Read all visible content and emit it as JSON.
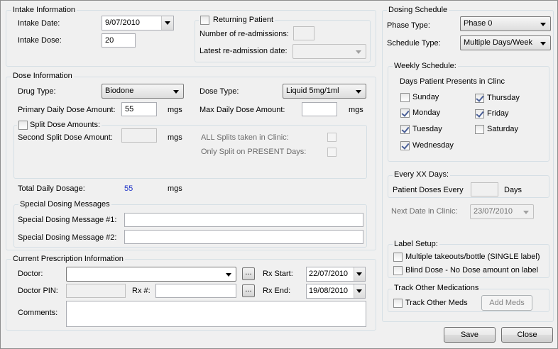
{
  "intake": {
    "title": "Intake Information",
    "date_label": "Intake Date:",
    "date_value": "9/07/2010",
    "dose_label": "Intake Dose:",
    "dose_value": "20",
    "returning_label": "Returning Patient",
    "returning_checked": false,
    "readmissions_label": "Number of re-admissions:",
    "readmissions_value": "",
    "latest_readmission_label": "Latest re-admission date:",
    "latest_readmission_value": ""
  },
  "dose_info": {
    "title": "Dose Information",
    "drug_type_label": "Drug Type:",
    "drug_type_value": "Biodone",
    "dose_type_label": "Dose Type:",
    "dose_type_value": "Liquid 5mg/1ml",
    "primary_label": "Primary Daily Dose Amount:",
    "primary_value": "55",
    "primary_unit": "mgs",
    "max_label": "Max Daily Dose Amount:",
    "max_value": "",
    "max_unit": "mgs",
    "split_label": "Split Dose Amounts:",
    "second_split_label": "Second Split Dose Amount:",
    "second_split_value": "",
    "second_split_unit": "mgs",
    "all_splits_label": "ALL Splits taken in Clinic:",
    "only_split_label": "Only Split on PRESENT Days:",
    "total_label": "Total Daily Dosage:",
    "total_value": "55",
    "total_unit": "mgs"
  },
  "special": {
    "title": "Special Dosing Messages",
    "msg1_label": "Special Dosing Message #1:",
    "msg1_value": "",
    "msg2_label": "Special Dosing Message #2:",
    "msg2_value": ""
  },
  "prescription": {
    "title": "Current Prescription Information",
    "doctor_label": "Doctor:",
    "doctor_value": "",
    "rx_start_label": "Rx Start:",
    "rx_start_value": "22/07/2010",
    "pin_label": "Doctor PIN:",
    "pin_value": "",
    "rx_num_label": "Rx #:",
    "rx_num_value": "",
    "rx_end_label": "Rx End:",
    "rx_end_value": "19/08/2010",
    "comments_label": "Comments:",
    "comments_value": "",
    "ellipsis": "..."
  },
  "schedule": {
    "title": "Dosing Schedule",
    "phase_label": "Phase Type:",
    "phase_value": "Phase 0",
    "type_label": "Schedule Type:",
    "type_value": "Multiple Days/Week",
    "weekly_title": "Weekly Schedule:",
    "days_heading": "Days Patient Presents in Clinc",
    "days": {
      "sunday": {
        "label": "Sunday",
        "checked": false
      },
      "monday": {
        "label": "Monday",
        "checked": true
      },
      "tuesday": {
        "label": "Tuesday",
        "checked": true
      },
      "wednesday": {
        "label": "Wednesday",
        "checked": true
      },
      "thursday": {
        "label": "Thursday",
        "checked": true
      },
      "friday": {
        "label": "Friday",
        "checked": true
      },
      "saturday": {
        "label": "Saturday",
        "checked": false
      }
    },
    "every_title": "Every XX Days:",
    "every_label": "Patient Doses Every",
    "every_value": "",
    "every_unit": "Days",
    "next_date_label": "Next Date in Clinic:",
    "next_date_value": "23/07/2010"
  },
  "label_setup": {
    "title": "Label Setup:",
    "multiple_label": "Multiple takeouts/bottle (SINGLE label)",
    "blind_label": "Blind Dose - No Dose amount on label"
  },
  "track": {
    "title": "Track Other Medications",
    "track_label": "Track Other Meds",
    "add_meds": "Add Meds"
  },
  "actions": {
    "save": "Save",
    "close": "Close"
  }
}
